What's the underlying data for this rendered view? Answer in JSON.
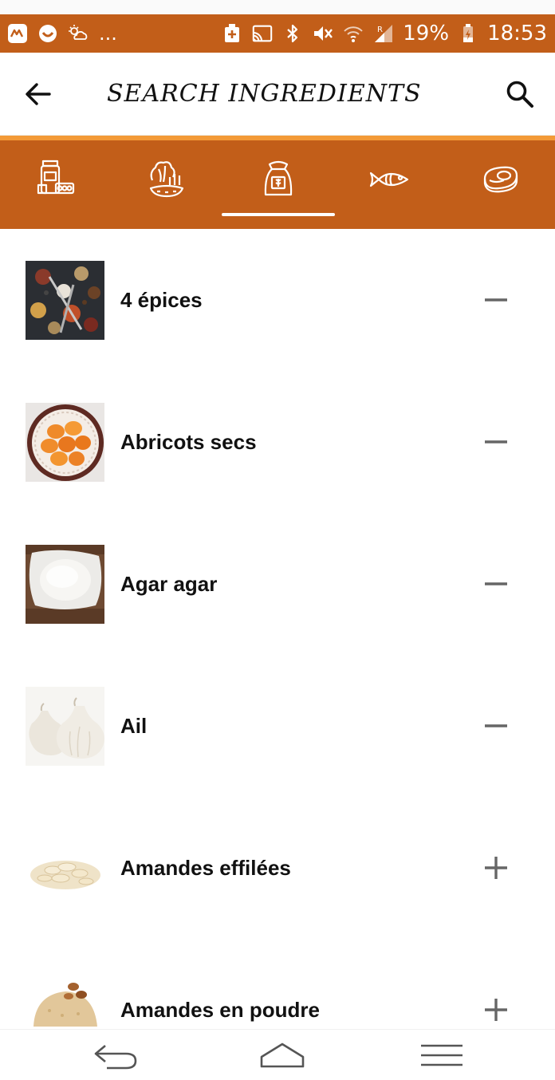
{
  "status_bar": {
    "battery_percent": "19%",
    "time": "18:53",
    "more_indicator": "...",
    "icons": [
      "app-icon",
      "circle-app-icon",
      "weather-icon",
      "battery-saver-icon",
      "cast-icon",
      "bluetooth-icon",
      "mute-icon",
      "wifi-icon",
      "signal-icon",
      "battery-icon"
    ]
  },
  "app_bar": {
    "title": "SEARCH INGREDIENTS",
    "back_icon": "arrow-left-icon",
    "search_icon": "search-icon"
  },
  "colors": {
    "primary": "#c25e19",
    "accent": "#f39a37",
    "text": "#111111",
    "action": "#666666"
  },
  "tabs": [
    {
      "icon": "pantry-jars-icon",
      "selected": false
    },
    {
      "icon": "vegetables-icon",
      "selected": false
    },
    {
      "icon": "flour-sack-icon",
      "selected": true
    },
    {
      "icon": "fish-icon",
      "selected": false
    },
    {
      "icon": "meat-steak-icon",
      "selected": false
    }
  ],
  "ingredients": [
    {
      "name": "4 épices",
      "action": "−",
      "action_icon": "minus-icon",
      "image": "spices"
    },
    {
      "name": "Abricots secs",
      "action": "−",
      "action_icon": "minus-icon",
      "image": "dried-apricots"
    },
    {
      "name": "Agar agar",
      "action": "−",
      "action_icon": "minus-icon",
      "image": "agar-powder"
    },
    {
      "name": "Ail",
      "action": "−",
      "action_icon": "minus-icon",
      "image": "garlic"
    },
    {
      "name": "Amandes effilées",
      "action": "+",
      "action_icon": "plus-icon",
      "image": "sliced-almonds"
    },
    {
      "name": "Amandes en poudre",
      "action": "+",
      "action_icon": "plus-icon",
      "image": "almond-powder"
    }
  ],
  "nav_bar": {
    "icons": [
      "back-nav-icon",
      "home-nav-icon",
      "menu-nav-icon"
    ]
  }
}
